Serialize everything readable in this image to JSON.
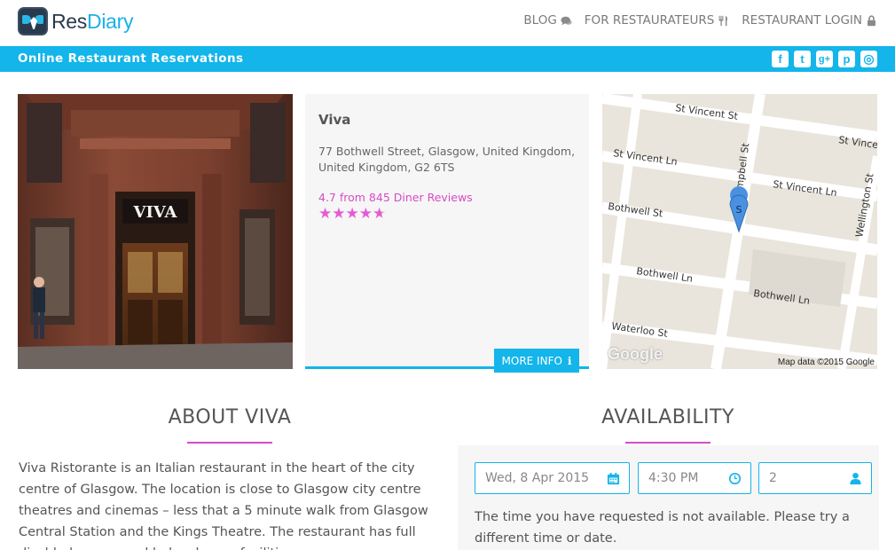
{
  "brand": {
    "name_part1": "Res",
    "name_part2": "Diary"
  },
  "nav": {
    "blog": "BLOG",
    "restaurateurs": "FOR RESTAURATEURS",
    "login": "RESTAURANT LOGIN"
  },
  "band": {
    "title": "Online Restaurant Reservations",
    "socials": [
      {
        "icon": "facebook-icon",
        "glyph": "f"
      },
      {
        "icon": "twitter-icon",
        "glyph": "t"
      },
      {
        "icon": "google-plus-icon",
        "glyph": "g+"
      },
      {
        "icon": "pinterest-icon",
        "glyph": "p"
      },
      {
        "icon": "instagram-icon",
        "glyph": "◎"
      }
    ]
  },
  "restaurant": {
    "sign_text": "VIVA",
    "name": "Viva",
    "address": "77 Bothwell Street, Glasgow, United Kingdom, United Kingdom, G2 6TS",
    "reviews": "4.7 from 845 Diner Reviews",
    "rating": 4.7,
    "rating_max": 5,
    "more_info": "MORE INFO"
  },
  "map": {
    "credit": "Map data ©2015 Google",
    "logo": "Google",
    "marker_label": "S",
    "streets": [
      "St Vincent St",
      "St Vince",
      "St Vincent Ln",
      "St Vincent Ln",
      "Bothwell St",
      "Bothwell Ln",
      "Bothwell Ln",
      "Waterloo St",
      "Campbell St",
      "Wellington St"
    ]
  },
  "about": {
    "title": "ABOUT VIVA",
    "text": "Viva Ristorante is an Italian restaurant in the heart of the city centre of Glasgow. The location is close to Glasgow city centre theatres and cinemas – less that a 5 minute walk from Glasgow Central Station and the Kings Theatre. The restaurant has full disabled access and baby change facilities."
  },
  "availability": {
    "title": "AVAILABILITY",
    "date": "Wed, 8 Apr 2015",
    "time": "4:30 PM",
    "party_size": "2",
    "message": "The time you have requested is not available. Please try a different time or date."
  },
  "colors": {
    "accent": "#13b5ea",
    "highlight": "#d64cc4",
    "dark": "#2a3a4c"
  }
}
